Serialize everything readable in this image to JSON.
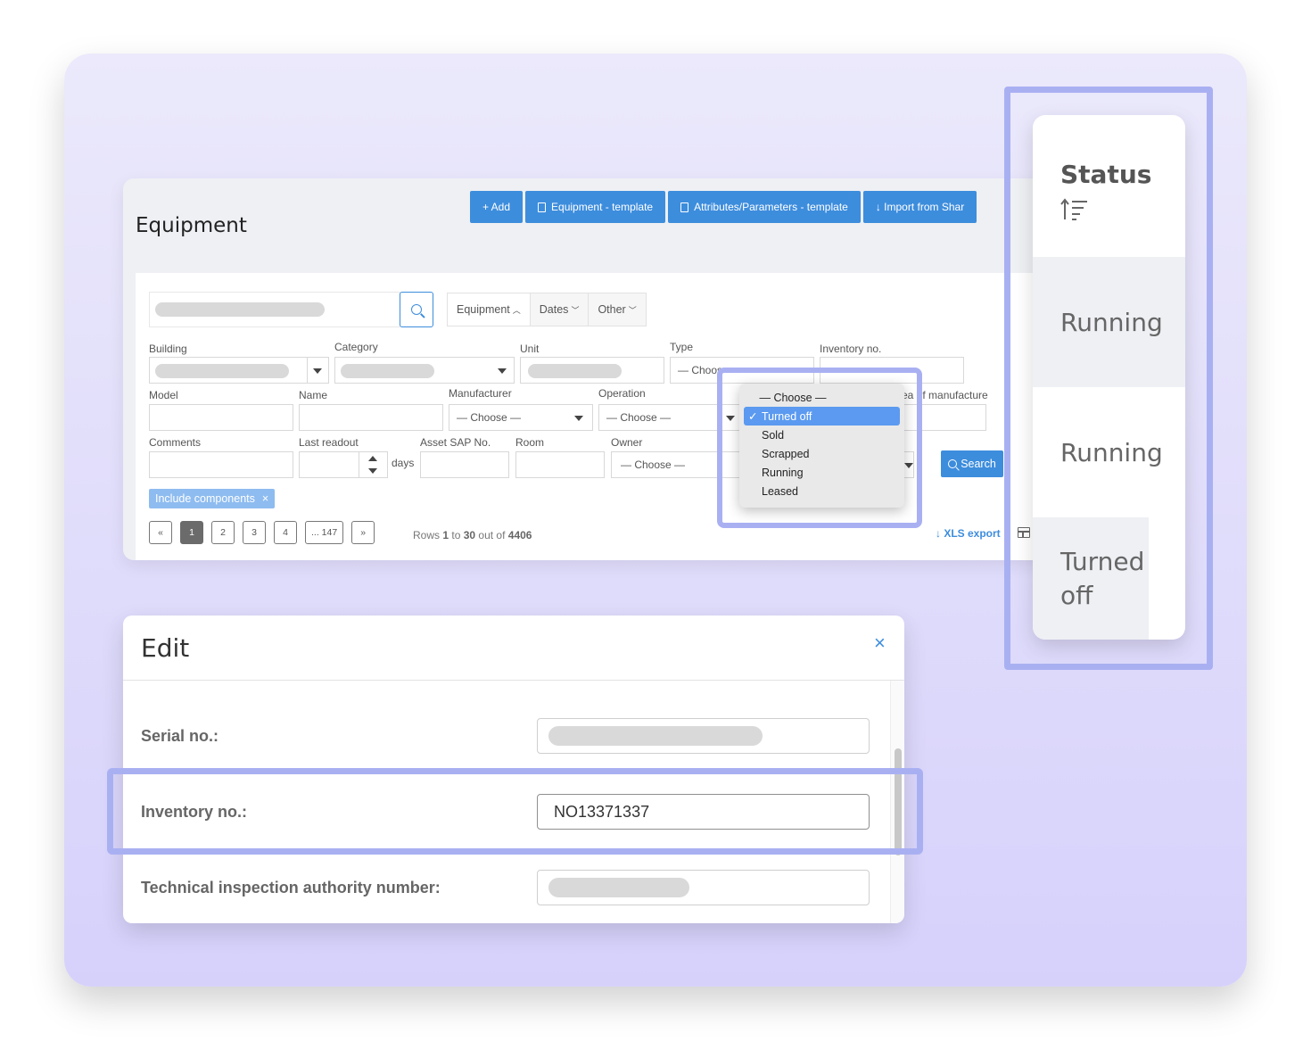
{
  "equipment": {
    "title": "Equipment",
    "toolbar": {
      "add": "+ Add",
      "equipment_template": "Equipment - template",
      "attributes_template": "Attributes/Parameters - template",
      "import": "↓ Import from Shar"
    },
    "filter_tabs": [
      "Equipment",
      "Dates",
      "Other"
    ],
    "filters": {
      "building": "Building",
      "category": "Category",
      "unit": "Unit",
      "type": "Type",
      "type_value": "— Choos",
      "inventory_no": "Inventory no.",
      "model": "Model",
      "name": "Name",
      "manufacturer": "Manufacturer",
      "manufacturer_value": "— Choose —",
      "operation": "Operation",
      "operation_value": "— Choose —",
      "year_of_manufacture": "ea of manufacture",
      "comments": "Comments",
      "last_readout": "Last readout",
      "days": "days",
      "asset_sap": "Asset SAP No.",
      "room": "Room",
      "owner": "Owner",
      "owner_value": "— Choose —"
    },
    "search_button": "Search",
    "include_components": "Include components",
    "remove_tag": "×",
    "pagination": [
      "«",
      "1",
      "2",
      "3",
      "4",
      "... 147",
      "»"
    ],
    "rows_info": {
      "prefix": "Rows ",
      "from": "1",
      "to_word": " to ",
      "to": "30",
      "of_word": " out of ",
      "total": "4406"
    },
    "xls_export": "↓ XLS export"
  },
  "status_dropdown": {
    "options": [
      "— Choose —",
      "Turned off",
      "Sold",
      "Scrapped",
      "Running",
      "Leased"
    ],
    "selected": "Turned off",
    "check": "✓"
  },
  "status_column": {
    "header": "Status",
    "rows": [
      "Running",
      "Running",
      "Turned off"
    ]
  },
  "edit_modal": {
    "title": "Edit",
    "close": "×",
    "serial_label": "Serial no.:",
    "inventory_label": "Inventory no.:",
    "inventory_value": "NO13371337",
    "tia_label": "Technical inspection authority number:"
  }
}
